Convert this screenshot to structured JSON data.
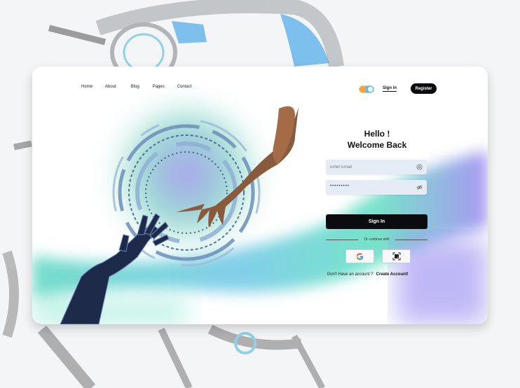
{
  "nav": {
    "items": [
      "Home",
      "About",
      "Blog",
      "Pages",
      "Contact"
    ]
  },
  "header": {
    "signin_label": "Sign in",
    "register_label": "Register"
  },
  "login": {
    "greeting": "Hello !",
    "welcome": "Welcome Back",
    "email_placeholder": "Enter Email",
    "password_mask": "•••••••••",
    "submit_label": "Sign In",
    "divider_text": "Or continue with",
    "account_prompt": "Don't Have an account ?",
    "create_account_label": "Create Account!"
  },
  "icons": {
    "email": "at-icon",
    "password": "eye-slash-icon",
    "google": "google-icon",
    "qr": "qr-scan-icon",
    "theme": "theme-toggle"
  },
  "colors": {
    "primary_button": "#0b0c10",
    "field_bg": "#e6ecf6",
    "accent_teal": "#5ee0c0",
    "accent_purple": "#8a7ff0"
  }
}
